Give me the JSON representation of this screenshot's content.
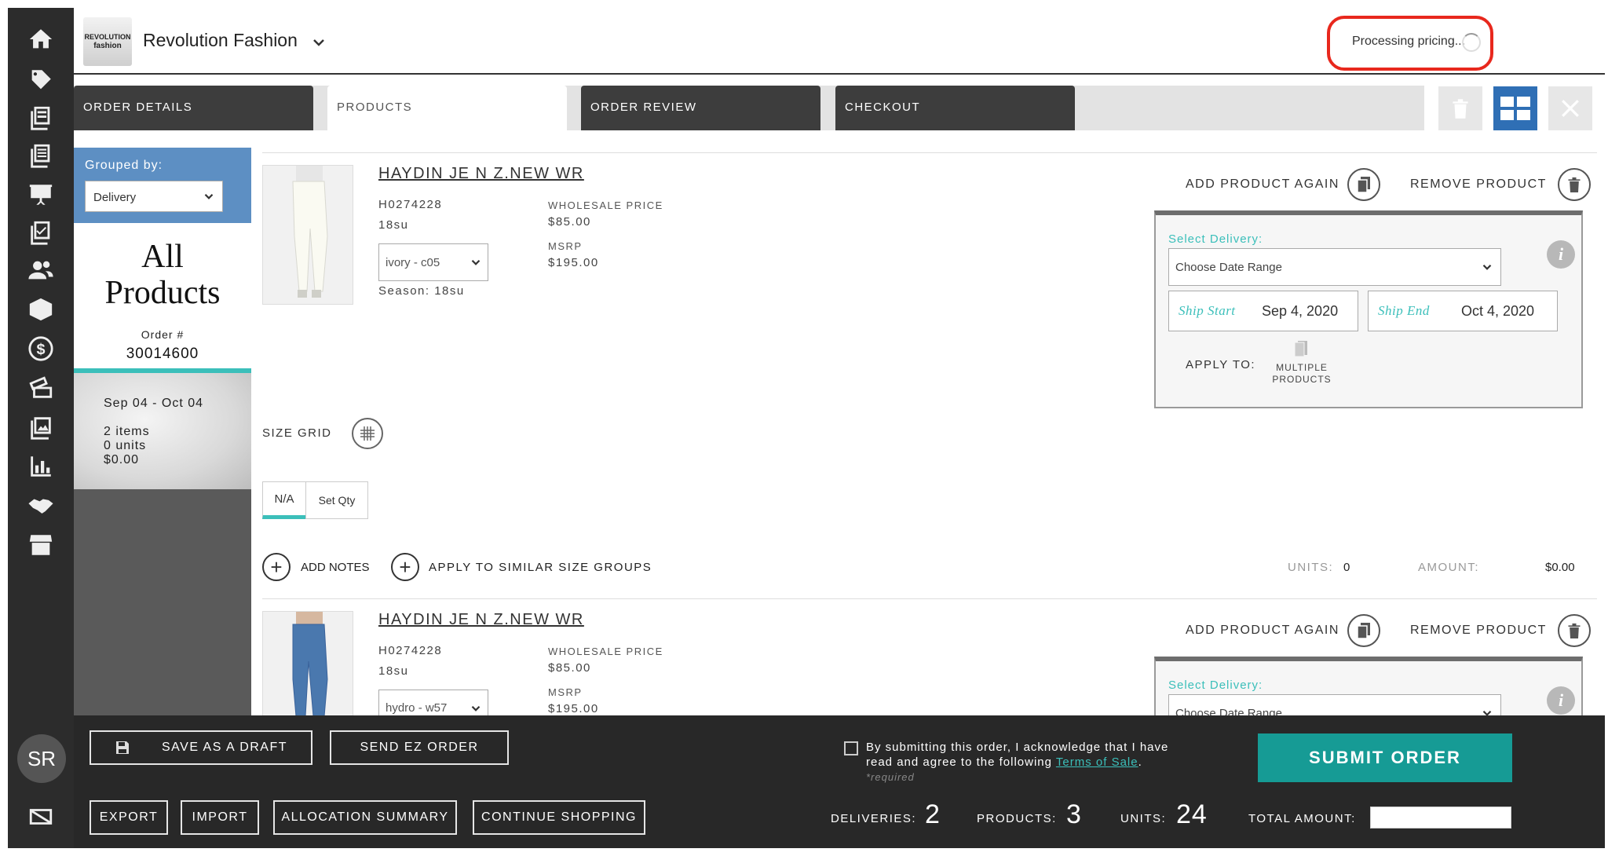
{
  "header": {
    "logo_line1": "REVOLUTION",
    "logo_line2": "fashion",
    "brand": "Revolution Fashion",
    "processing": "Processing pricing..."
  },
  "sidebar": {
    "icons": [
      "home-icon",
      "tag-icon",
      "catalog-icon",
      "list-icon",
      "presentation-icon",
      "checklist-icon",
      "users-icon",
      "box-icon",
      "dollar-icon",
      "ticket-icon",
      "images-icon",
      "chart-icon",
      "handshake-icon",
      "storefront-icon"
    ],
    "avatar": "SR",
    "bottom_icon": "card-icon"
  },
  "tabs": [
    {
      "label": "ORDER DETAILS",
      "active": false
    },
    {
      "label": "PRODUCTS",
      "active": true
    },
    {
      "label": "ORDER REVIEW",
      "active": false
    },
    {
      "label": "CHECKOUT",
      "active": false
    }
  ],
  "left_panel": {
    "grouped_by_label": "Grouped by:",
    "grouped_by_value": "Delivery",
    "title_line1": "All",
    "title_line2": "Products",
    "order_label": "Order #",
    "order_number": "30014600",
    "delivery_card": {
      "dates": "Sep 04 - Oct 04",
      "items": "2 items",
      "units": "0 units",
      "amount": "$0.00"
    }
  },
  "products": [
    {
      "name": "HAYDIN JE N Z.NEW WR",
      "sku": "H0274228",
      "season_code": "18su",
      "color": "ivory - c05",
      "season": "Season: 18su",
      "wholesale_label": "WHOLESALE PRICE",
      "wholesale_price": "$85.00",
      "msrp_label": "MSRP",
      "msrp": "$195.00",
      "add_again": "ADD PRODUCT AGAIN",
      "remove": "REMOVE PRODUCT",
      "delivery": {
        "select_label": "Select Delivery:",
        "date_range": "Choose Date Range",
        "ship_start_label": "Ship Start",
        "ship_start": "Sep 4, 2020",
        "ship_end_label": "Ship End",
        "ship_end": "Oct 4, 2020",
        "apply_to": "APPLY TO:",
        "multiple_line1": "MULTIPLE",
        "multiple_line2": "PRODUCTS"
      },
      "size_grid": "SIZE GRID",
      "qty_tabs": [
        "N/A",
        "Set Qty"
      ],
      "add_notes": "ADD NOTES",
      "apply_similar": "APPLY TO SIMILAR SIZE GROUPS",
      "units_label": "UNITS:",
      "units": "0",
      "amount_label": "AMOUNT:",
      "amount": "$0.00"
    },
    {
      "name": "HAYDIN JE N Z.NEW WR",
      "sku": "H0274228",
      "season_code": "18su",
      "color": "hydro - w57",
      "wholesale_label": "WHOLESALE PRICE",
      "wholesale_price": "$85.00",
      "msrp_label": "MSRP",
      "msrp": "$195.00",
      "add_again": "ADD PRODUCT AGAIN",
      "remove": "REMOVE PRODUCT",
      "delivery": {
        "select_label": "Select Delivery:",
        "date_range": "Choose Date Range"
      }
    }
  ],
  "footer": {
    "save_draft": "SAVE AS A DRAFT",
    "send_ez": "SEND EZ ORDER",
    "export": "EXPORT",
    "import": "IMPORT",
    "allocation": "ALLOCATION SUMMARY",
    "continue": "CONTINUE SHOPPING",
    "terms_line1": "By submitting this order, I acknowledge that I have",
    "terms_line2_prefix": "read and agree to the following ",
    "terms_link": "Terms of Sale",
    "terms_line2_suffix": ".",
    "required": "*required",
    "submit": "SUBMIT ORDER",
    "deliveries_label": "DELIVERIES:",
    "deliveries": "2",
    "products_label": "PRODUCTS:",
    "products": "3",
    "units_label": "UNITS:",
    "units": "24",
    "total_label": "TOTAL AMOUNT:"
  },
  "colors": {
    "accent": "#169b95",
    "teal_text": "#3bbfba",
    "alert_red": "#e8281d",
    "group_blue": "#5d8fc3",
    "sidebar": "#2c2c2c"
  }
}
